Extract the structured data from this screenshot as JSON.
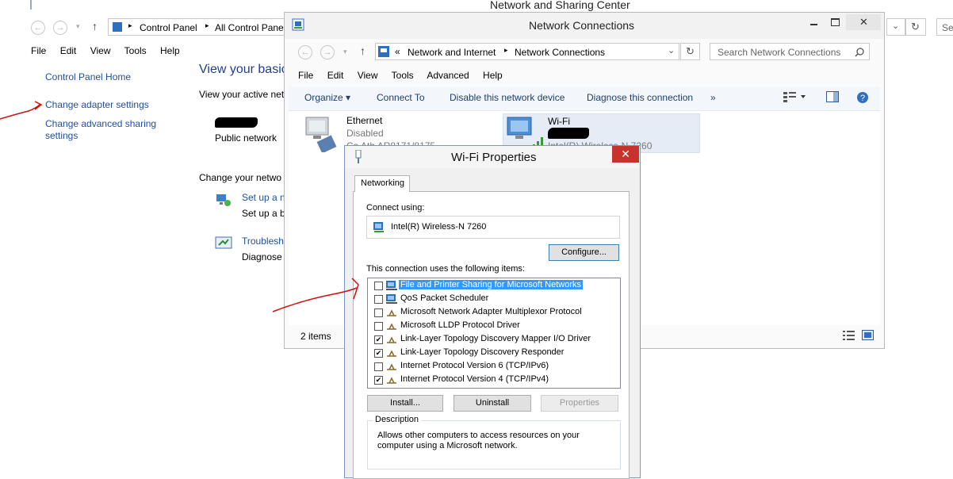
{
  "background_window": {
    "title": "Network and Sharing Center",
    "breadcrumb": [
      "Control Panel",
      "All Control Pane"
    ],
    "menu": [
      "File",
      "Edit",
      "View",
      "Tools",
      "Help"
    ],
    "search_placeholder": "Se",
    "left_links": [
      "Control Panel Home",
      "Change adapter settings",
      "Change advanced sharing",
      "settings"
    ],
    "heading": "View your basic",
    "active_networks_label": "View your active net",
    "network_type": "Public network",
    "change_heading": "Change your netwo",
    "task1_link": "Set up a n",
    "task1_desc": "Set up a b",
    "task2_link": "Troublesh",
    "task2_desc": "Diagnose"
  },
  "network_connections": {
    "title": "Network Connections",
    "breadcrumb_prefix": "«",
    "breadcrumb": [
      "Network and Internet",
      "Network Connections"
    ],
    "search_placeholder": "Search Network Connections",
    "menu": [
      "File",
      "Edit",
      "View",
      "Tools",
      "Advanced",
      "Help"
    ],
    "commands": [
      "Organize ▾",
      "Connect To",
      "Disable this network device",
      "Diagnose this connection",
      "»"
    ],
    "adapters": [
      {
        "name": "Ethernet",
        "status": "Disabled",
        "detail": "Ca        Ath      AR8171/8175"
      },
      {
        "name": "Wi-Fi",
        "status": "",
        "detail": "Intel(R) Wireless-N 7260"
      }
    ],
    "status_bar": "2 items"
  },
  "wifi_properties": {
    "title": "Wi-Fi Properties",
    "close_glyph": "✕",
    "tab": "Networking",
    "connect_using_label": "Connect using:",
    "adapter_name": "Intel(R) Wireless-N 7260",
    "configure_button": "Configure...",
    "items_label": "This connection uses the following items:",
    "items": [
      {
        "label": "File and Printer Sharing for Microsoft Networks",
        "checked": false,
        "selected": true,
        "icon": "network-client-icon"
      },
      {
        "label": "QoS Packet Scheduler",
        "checked": false,
        "selected": false,
        "icon": "network-client-icon"
      },
      {
        "label": "Microsoft Network Adapter Multiplexor Protocol",
        "checked": false,
        "selected": false,
        "icon": "protocol-icon"
      },
      {
        "label": "Microsoft LLDP Protocol Driver",
        "checked": false,
        "selected": false,
        "icon": "protocol-icon"
      },
      {
        "label": "Link-Layer Topology Discovery Mapper I/O Driver",
        "checked": true,
        "selected": false,
        "icon": "protocol-icon"
      },
      {
        "label": "Link-Layer Topology Discovery Responder",
        "checked": true,
        "selected": false,
        "icon": "protocol-icon"
      },
      {
        "label": "Internet Protocol Version 6 (TCP/IPv6)",
        "checked": false,
        "selected": false,
        "icon": "protocol-icon"
      },
      {
        "label": "Internet Protocol Version 4 (TCP/IPv4)",
        "checked": true,
        "selected": false,
        "icon": "protocol-icon"
      }
    ],
    "install_button": "Install...",
    "uninstall_button": "Uninstall",
    "properties_button": "Properties",
    "description_label": "Description",
    "description_text": "Allows other computers to access resources on your computer using a Microsoft network.",
    "checkmark": "✔"
  },
  "colors": {
    "selection": "#3399ff",
    "link": "#1e4f9c",
    "annotation": "#d01010",
    "close": "#c7322c"
  }
}
